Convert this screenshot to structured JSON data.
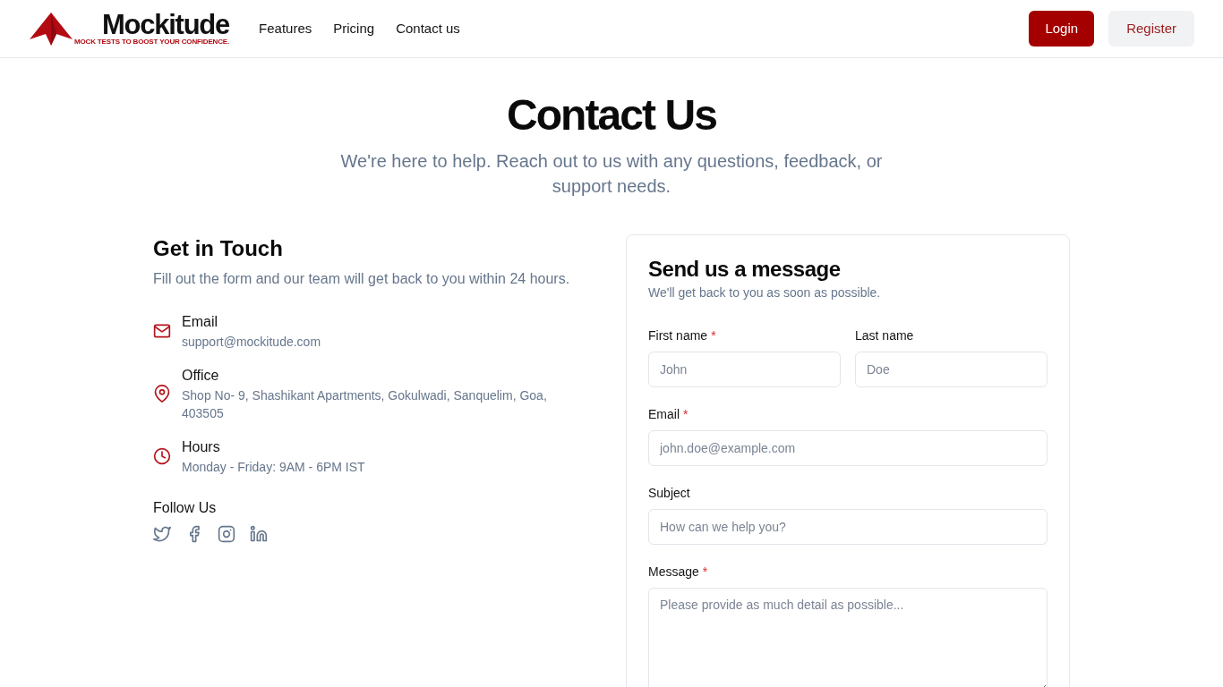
{
  "header": {
    "logo": {
      "name": "Mockitude",
      "tagline": "MOCK TESTS TO BOOST YOUR CONFIDENCE."
    },
    "nav": [
      {
        "label": "Features"
      },
      {
        "label": "Pricing"
      },
      {
        "label": "Contact us"
      }
    ],
    "buttons": [
      {
        "label": "Login",
        "kind": "primary"
      },
      {
        "label": "Register",
        "kind": "secondary"
      }
    ]
  },
  "hero": {
    "title": "Contact Us",
    "subtitle": "We're here to help. Reach out to us with any questions, feedback, or support needs."
  },
  "contact_info": {
    "title": "Get in Touch",
    "description": "Fill out the form and our team will get back to you within 24 hours.",
    "items": [
      {
        "kind": "email",
        "label": "Email",
        "value": "support@mockitude.com"
      },
      {
        "kind": "location",
        "label": "Office",
        "value": "Shop No- 9, Shashikant Apartments, Gokulwadi, Sanquelim, Goa, 403505"
      },
      {
        "kind": "hours",
        "label": "Hours",
        "value": "Monday - Friday: 9AM - 6PM IST"
      }
    ],
    "follow": {
      "title": "Follow Us",
      "links": [
        {
          "kind": "twitter"
        },
        {
          "kind": "facebook"
        },
        {
          "kind": "instagram"
        },
        {
          "kind": "linkedin"
        }
      ]
    }
  },
  "form": {
    "title": "Send us a message",
    "subtitle": "We'll get back to you as soon as possible.",
    "rows": [
      [
        {
          "kind": "input",
          "label": "First name",
          "required_mark": "*",
          "placeholder": "John"
        },
        {
          "kind": "input",
          "label": "Last name",
          "placeholder": "Doe"
        }
      ],
      [
        {
          "kind": "input",
          "label": "Email",
          "required_mark": "*",
          "placeholder": "john.doe@example.com"
        }
      ],
      [
        {
          "kind": "input",
          "label": "Subject",
          "placeholder": "How can we help you?"
        }
      ],
      [
        {
          "kind": "textarea",
          "label": "Message",
          "required_mark": "*",
          "placeholder": "Please provide as much detail as possible..."
        }
      ]
    ]
  }
}
